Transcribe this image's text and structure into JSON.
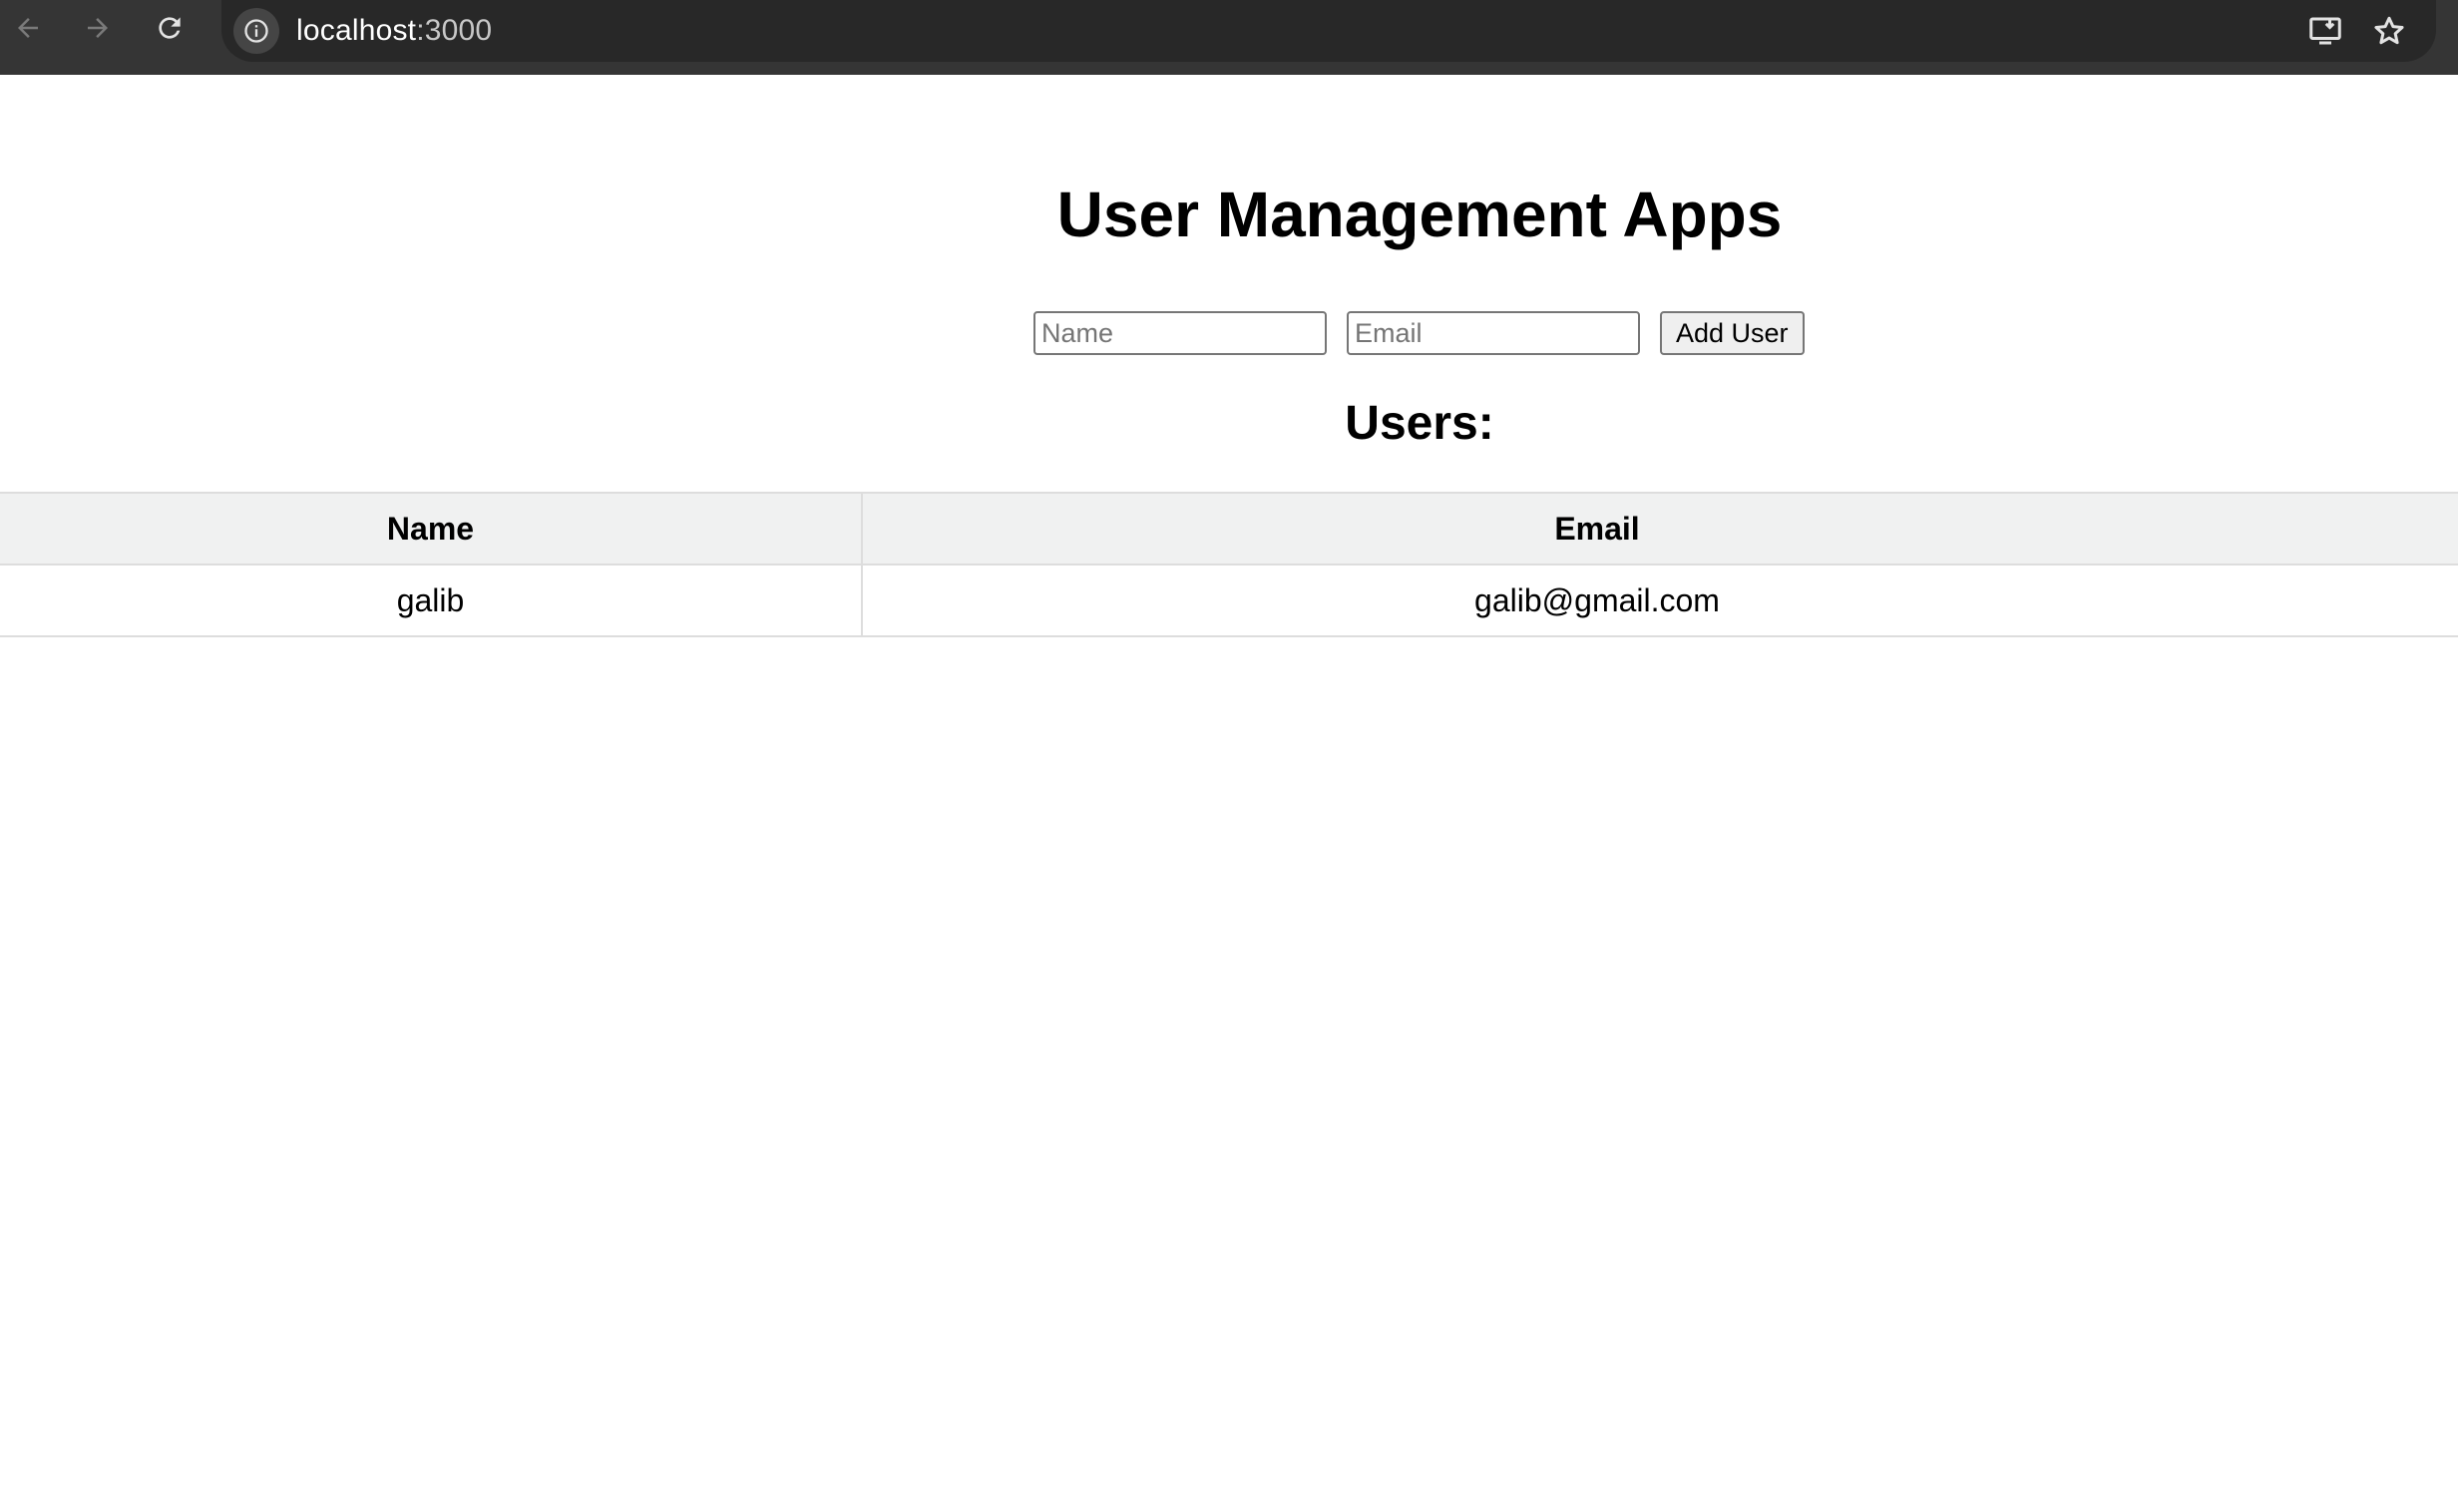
{
  "browser": {
    "url_host": "localhost",
    "url_port": ":3000",
    "icons": {
      "back": "arrow-left-icon",
      "forward": "arrow-right-icon",
      "reload": "reload-icon",
      "site_info": "info-icon",
      "install": "install-app-icon",
      "bookmark": "star-icon"
    }
  },
  "app": {
    "title": "User Management Apps",
    "form": {
      "name_placeholder": "Name",
      "email_placeholder": "Email",
      "name_value": "",
      "email_value": "",
      "add_button_label": "Add User"
    },
    "users_heading": "Users:",
    "table": {
      "headers": [
        "Name",
        "Email"
      ],
      "rows": [
        {
          "name": "galib",
          "email": "galib@gmail.com"
        }
      ]
    }
  },
  "colors": {
    "chrome_bar": "#353535",
    "omnibox": "#282828",
    "table_header_bg": "#f0f1f1",
    "table_border": "#dddddd"
  }
}
